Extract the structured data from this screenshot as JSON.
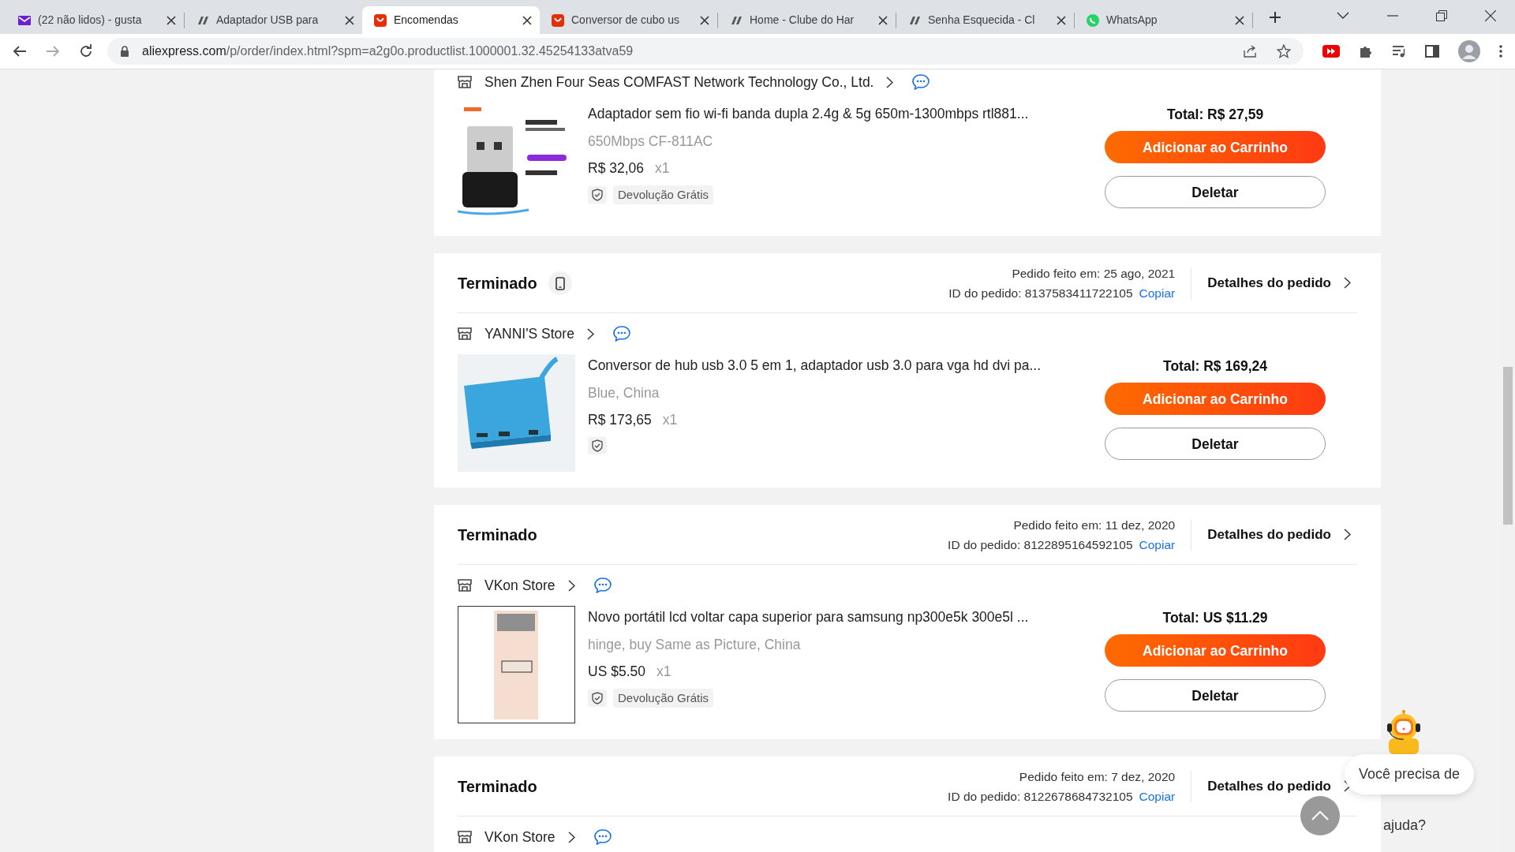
{
  "browser": {
    "tabs": [
      {
        "title": "(22 não lidos) - gusta",
        "kind": "mail",
        "selected": false
      },
      {
        "title": "Adaptador USB para",
        "kind": "forum",
        "selected": false
      },
      {
        "title": "Encomendas",
        "kind": "shop",
        "selected": true
      },
      {
        "title": "Conversor de cubo us",
        "kind": "shop",
        "selected": false
      },
      {
        "title": "Home - Clube do Har",
        "kind": "forum",
        "selected": false
      },
      {
        "title": "Senha Esquecida - Cl",
        "kind": "forum",
        "selected": false
      },
      {
        "title": "WhatsApp",
        "kind": "chat",
        "selected": false
      }
    ],
    "url_host": "aliexpress.com",
    "url_path": "/p/order/index.html?spm=a2g0o.productlist.1000001.32.45254133atva59"
  },
  "orders": [
    {
      "store": "Shen Zhen Four Seas COMFAST Network Technology Co., Ltd.",
      "items": [
        {
          "kind": "adapter",
          "title": "Adaptador sem fio wi-fi banda dupla 2.4g & 5g 650m-1300mbps rtl881...",
          "variant": "650Mbps CF-811AC",
          "price": "R$ 32,06",
          "qty": "x1",
          "badge": "Devolução Grátis"
        }
      ],
      "total": "Total: R$ 27,59",
      "add_label": "Adicionar ao Carrinho",
      "delete_label": "Deletar"
    },
    {
      "status": "Terminado",
      "device_icon": true,
      "date": "Pedido feito em: 25 ago, 2021",
      "order_id": "ID do pedido: 8137583411722105",
      "copy_label": "Copiar",
      "details_label": "Detalhes do pedido",
      "store": "YANNI'S Store",
      "items": [
        {
          "kind": "hub",
          "title": "Conversor de hub usb 3.0 5 em 1, adaptador usb 3.0 para vga hd dvi pa...",
          "variant": "Blue, China",
          "price": "R$ 173,65",
          "qty": "x1"
        }
      ],
      "total": "Total: R$ 169,24",
      "add_label": "Adicionar ao Carrinho",
      "delete_label": "Deletar"
    },
    {
      "status": "Terminado",
      "device_icon": false,
      "date": "Pedido feito em: 11 dez, 2020",
      "order_id": "ID do pedido: 8122895164592105",
      "copy_label": "Copiar",
      "details_label": "Detalhes do pedido",
      "store": "VKon Store",
      "items": [
        {
          "kind": "cover",
          "title": "Novo portátil lcd voltar capa superior para samsung np300e5k 300e5l ...",
          "variant": "hinge, buy Same as Picture, China",
          "price": "US $5.50",
          "qty": "x1",
          "badge": "Devolução Grátis"
        }
      ],
      "total": "Total: US $11.29",
      "add_label": "Adicionar ao Carrinho",
      "delete_label": "Deletar"
    },
    {
      "status": "Terminado",
      "device_icon": false,
      "date": "Pedido feito em: 7 dez, 2020",
      "order_id": "ID do pedido: 8122678684732105",
      "copy_label": "Copiar",
      "details_label": "Detalhes do pedido",
      "store": "VKon Store"
    }
  ],
  "helper": {
    "line1": "Você precisa de",
    "line2": "ajuda?"
  }
}
